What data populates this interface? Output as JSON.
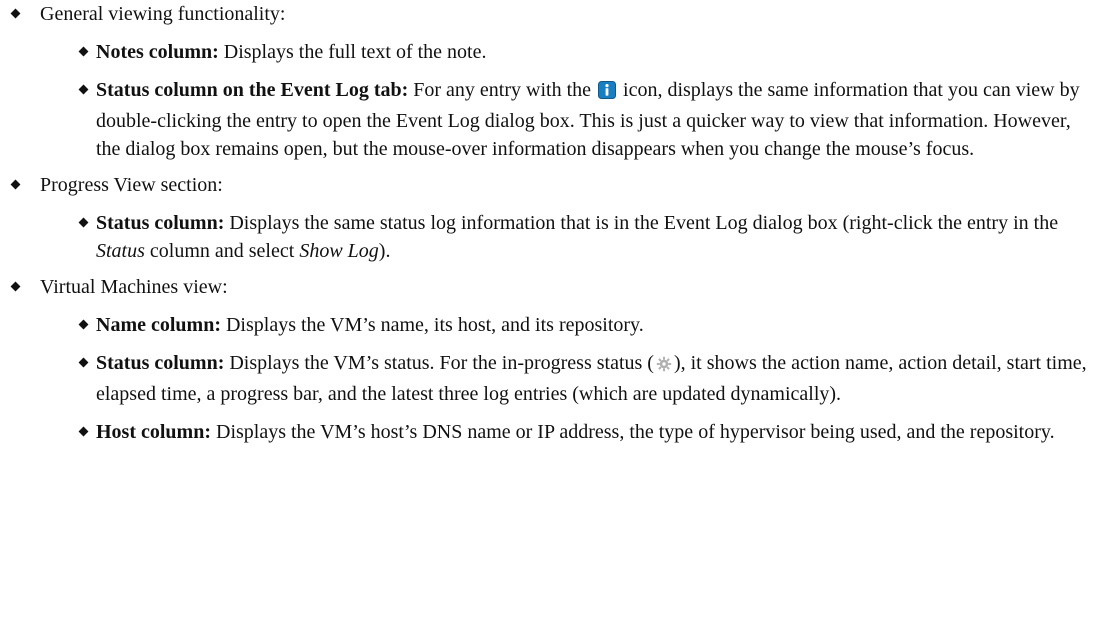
{
  "sections": [
    {
      "label": "General viewing functionality:",
      "items": [
        {
          "bold": "Notes column:",
          "parts": [
            " Displays the full text of the note."
          ]
        },
        {
          "bold": "Status column on the Event Log tab:",
          "parts": [
            " For any entry with the ",
            " icon, displays the same information that you can view by double-clicking the entry to open the Event Log dialog box. This is just a quicker way to view that information. However, the dialog box remains open, but the mouse-over information disappears when you change the mouse’s focus."
          ],
          "icon": "info-icon"
        }
      ]
    },
    {
      "label": "Progress View section:",
      "items": [
        {
          "bold": "Status column:",
          "parts": [
            " Displays the same status log information that is in the Event Log dialog box (right-click the entry in the ",
            "Status",
            " column and select ",
            "Show Log",
            ")."
          ]
        }
      ]
    },
    {
      "label": "Virtual Machines view:",
      "items": [
        {
          "bold": "Name column:",
          "parts": [
            " Displays the VM’s name, its host, and its repository."
          ]
        },
        {
          "bold": "Status column:",
          "parts": [
            " Displays the VM’s status. For the in-progress status (",
            "), it shows the action name, action detail, start time, elapsed time, a progress bar, and the latest three log entries (which are updated dynamically)."
          ],
          "icon": "in-progress-gear-icon"
        },
        {
          "bold": "Host column:",
          "parts": [
            " Displays the VM’s host’s DNS name or IP address, the type of hypervisor being used, and the repository."
          ]
        }
      ]
    }
  ],
  "colors": {
    "info_icon": "#1a7fc1",
    "gear_icon": "#b0b0b0",
    "text": "#111111"
  }
}
